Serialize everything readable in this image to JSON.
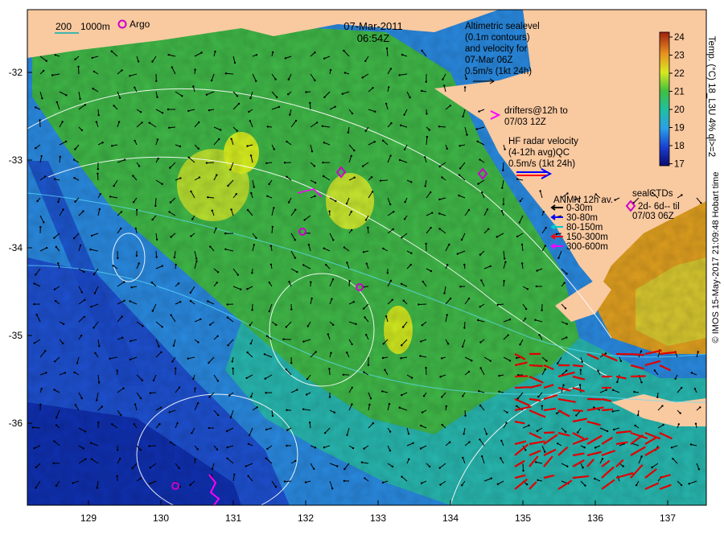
{
  "header": {
    "date": "07-Mar-2011",
    "time": "06:54Z"
  },
  "scale_bar": {
    "label_200": "200",
    "label_1000": "1000m"
  },
  "argo_legend": {
    "label": "Argo",
    "color": "#cc00cc"
  },
  "altimetry_note": {
    "lines": [
      "Altimetric sealevel",
      "(0.1m contours)",
      "and velocity for",
      "07-Mar 06Z",
      "0.5m/s (1kt 24h)"
    ]
  },
  "drifters_note": {
    "lines": [
      "drifters@12h to",
      "07/03 12Z"
    ],
    "color": "#ff00ff"
  },
  "hf_radar_note": {
    "lines": [
      "HF radar velocity",
      "(4-12h avg)QC",
      "0.5m/s (1kt 24h)"
    ]
  },
  "anmn_legend": {
    "title": "ANMN 12h av.",
    "items": [
      {
        "label": "0-30m",
        "color": "#000000"
      },
      {
        "label": "30-80m",
        "color": "#0000ff"
      },
      {
        "label": "80-150m",
        "color": "#00cccc"
      },
      {
        "label": "150-300m",
        "color": "#ff0000"
      },
      {
        "label": "300-600m",
        "color": "#ff00ff"
      }
    ]
  },
  "sealctd_legend": {
    "lines": [
      "sealCTDs",
      "2d- 6d-- til",
      "07/03 06Z"
    ],
    "color": "#cc00cc"
  },
  "colorbar": {
    "ticks": [
      "24",
      "23",
      "22",
      "21",
      "20",
      "19",
      "18",
      "17"
    ],
    "label": "Temp. (°C) 18_L3U 4% ql>=2"
  },
  "axes": {
    "x_ticks": [
      "129",
      "130",
      "131",
      "132",
      "133",
      "134",
      "135",
      "136",
      "137"
    ],
    "y_ticks": [
      "-32",
      "-33",
      "-34",
      "-35",
      "-36"
    ]
  },
  "credit": "© IMOS 15-May-2017 21:09:48 Hobart time",
  "colors": {
    "land": "#f9c9a0",
    "deep_blue": "#1a3cc8",
    "mid_blue": "#2a78e0",
    "cyan": "#1fb8c8",
    "green": "#3cb85a",
    "yellow": "#d8e820",
    "orange": "#e8a020"
  }
}
